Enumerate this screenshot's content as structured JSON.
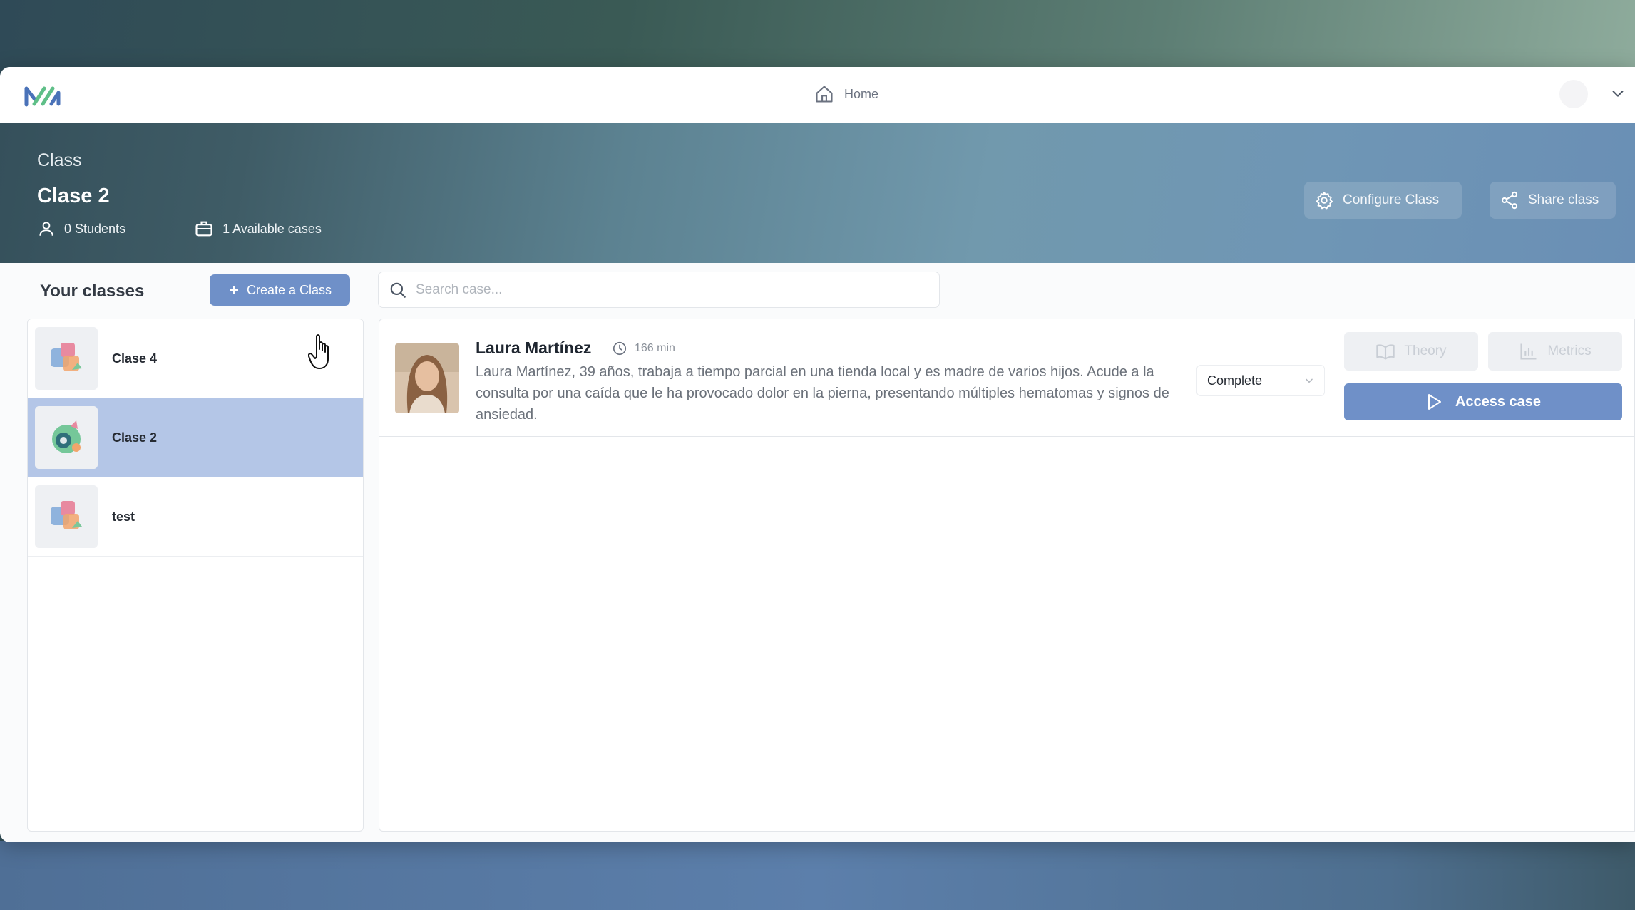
{
  "nav": {
    "home_label": "Home"
  },
  "hero": {
    "section_label": "Class",
    "title": "Clase 2",
    "students": "0 Students",
    "available_cases": "1 Available cases",
    "configure_label": "Configure Class",
    "share_label": "Share class"
  },
  "sidebar": {
    "heading": "Your classes",
    "create_label": "Create a Class",
    "items": [
      {
        "label": "Clase 4",
        "icon": "class-thumbnail-icon",
        "selected": false
      },
      {
        "label": "Clase 2",
        "icon": "class-thumbnail-icon",
        "selected": true
      },
      {
        "label": "test",
        "icon": "class-thumbnail-icon",
        "selected": false
      }
    ]
  },
  "search": {
    "placeholder": "Search case...",
    "value": ""
  },
  "cases": [
    {
      "name": "Laura Martínez",
      "duration": "166 min",
      "description": "Laura Martínez, 39 años, trabaja a tiempo parcial en una tienda local y es madre de varios hijos. Acude a la consulta por una caída que le ha provocado dolor en la pierna, presentando múltiples hematomas y signos de ansiedad.",
      "status": "Complete",
      "theory_label": "Theory",
      "metrics_label": "Metrics",
      "access_label": "Access case"
    }
  ],
  "colors": {
    "accent": "#6f90c8",
    "selected_row": "#b4c6e7",
    "logo_blue": "#4a72b8",
    "logo_green": "#5fbf88"
  }
}
